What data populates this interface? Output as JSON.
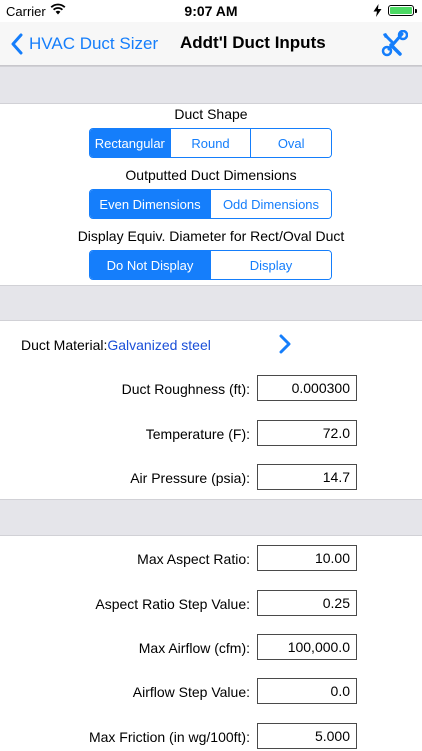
{
  "status_bar": {
    "carrier": "Carrier",
    "time": "9:07 AM"
  },
  "nav": {
    "back_label": "HVAC Duct Sizer",
    "title": "Addt'l Duct Inputs"
  },
  "duct_shape": {
    "caption": "Duct Shape",
    "options": [
      "Rectangular",
      "Round",
      "Oval"
    ],
    "selected": "Rectangular"
  },
  "output_dims": {
    "caption": "Outputted Duct Dimensions",
    "options": [
      "Even Dimensions",
      "Odd Dimensions"
    ],
    "selected": "Even Dimensions"
  },
  "equiv_diameter": {
    "caption": "Display Equiv. Diameter for Rect/Oval Duct",
    "options": [
      "Do Not Display",
      "Display"
    ],
    "selected": "Do Not Display"
  },
  "material": {
    "label": "Duct Material:",
    "value": "Galvanized steel"
  },
  "fields_group1": [
    {
      "label": "Duct Roughness (ft):",
      "value": "0.000300"
    },
    {
      "label": "Temperature (F):",
      "value": "72.0"
    },
    {
      "label": "Air Pressure (psia):",
      "value": "14.7"
    }
  ],
  "fields_group2": [
    {
      "label": "Max Aspect Ratio:",
      "value": "10.00"
    },
    {
      "label": "Aspect Ratio Step Value:",
      "value": "0.25"
    },
    {
      "label": "Max Airflow (cfm):",
      "value": "100,000.0"
    },
    {
      "label": "Airflow Step Value:",
      "value": "0.0"
    },
    {
      "label": "Max Friction (in wg/100ft):",
      "value": "5.000"
    }
  ],
  "colors": {
    "accent": "#157efb",
    "material_value": "#1a4fd8",
    "band": "#e5e5ea"
  }
}
